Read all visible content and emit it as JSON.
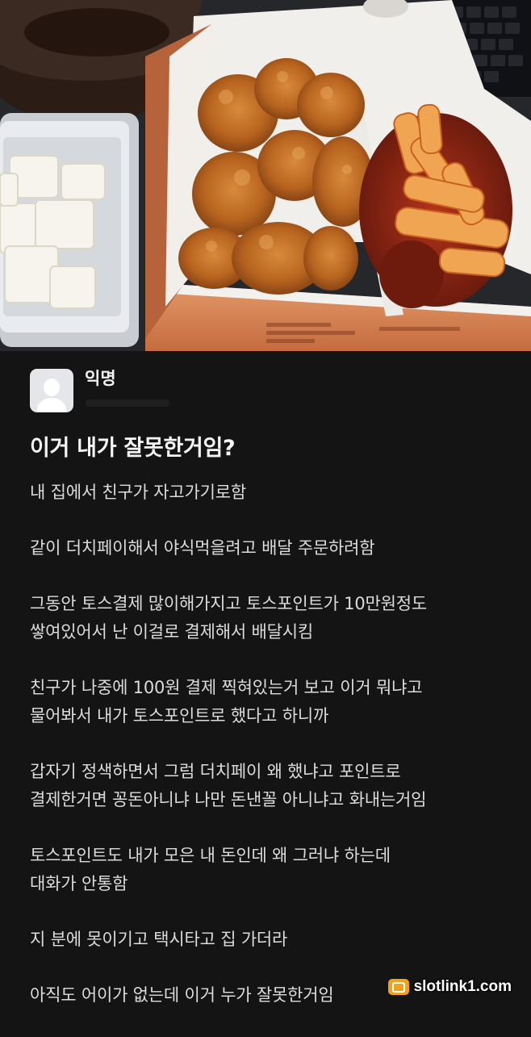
{
  "post": {
    "author": "익명",
    "title": "이거 내가 잘못한거임?",
    "paragraphs": [
      [
        "내 집에서 친구가 자고가기로함"
      ],
      [
        "같이 더치페이해서 야식먹을려고 배달 주문하려함"
      ],
      [
        "그동안 토스결제 많이해가지고 토스포인트가 10만원정도",
        "쌓여있어서 난 이걸로 결제해서 배달시킴"
      ],
      [
        "친구가 나중에 100원 결제 찍혀있는거 보고 이거 뭐냐고",
        "물어봐서 내가 토스포인트로 했다고 하니까"
      ],
      [
        "갑자기 정색하면서 그럼 더치페이 왜 했냐고 포인트로",
        "결제한거면 꽁돈아니냐 나만 돈낸꼴 아니냐고 화내는거임"
      ],
      [
        "토스포인트도 내가 모은 내 돈인데 왜 그러냐 하는데",
        "대화가 안통함"
      ],
      [
        "지 분에 못이기고 택시타고 집 가더라"
      ],
      [
        "아직도 어이가 없는데 이거 누가 잘못한거임"
      ]
    ]
  },
  "photo": {
    "description_icon": "food-photo"
  },
  "watermark": {
    "text": "slotlink1.com",
    "icon": "slot-icon",
    "accent": "#f0a21b"
  },
  "colors": {
    "background": "#141414",
    "text": "#dcdcdc",
    "title": "#f5f5f5"
  }
}
